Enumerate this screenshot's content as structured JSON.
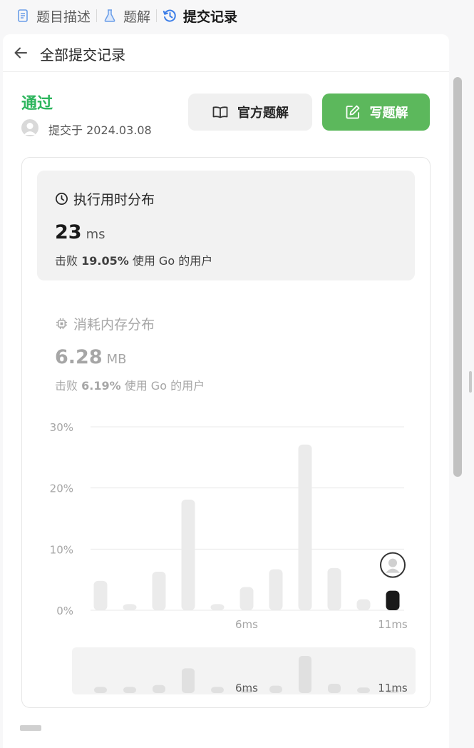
{
  "tabs": [
    {
      "label": "题目描述",
      "icon": "document-icon",
      "active": false
    },
    {
      "label": "题解",
      "icon": "flask-icon",
      "active": false
    },
    {
      "label": "提交记录",
      "icon": "history-icon",
      "active": true
    }
  ],
  "header": {
    "title": "全部提交记录"
  },
  "submission": {
    "status": "通过",
    "status_color": "#2db55d",
    "submitted_at": "提交于 2024.03.08"
  },
  "buttons": {
    "official": "官方题解",
    "write": "写题解"
  },
  "runtime": {
    "title": "执行用时分布",
    "value": "23",
    "unit": "ms",
    "beats_prefix": "击败",
    "beats_pct": "19.05%",
    "beats_suffix": "使用 Go 的用户"
  },
  "memory": {
    "title": "消耗内存分布",
    "value": "6.28",
    "unit": "MB",
    "beats_prefix": "击败",
    "beats_pct": "6.19%",
    "beats_suffix": "使用 Go 的用户"
  },
  "chart_data": {
    "type": "bar",
    "y_ticks": [
      "30%",
      "20%",
      "10%",
      "0%"
    ],
    "ylim": [
      0,
      30
    ],
    "x_tick_labels": [
      {
        "index": 5,
        "label": "6ms"
      },
      {
        "index": 10,
        "label": "11ms"
      }
    ],
    "values": [
      4.8,
      1.0,
      6.3,
      18.1,
      1.0,
      3.8,
      6.7,
      27.1,
      6.9,
      1.8,
      3.2
    ],
    "highlight_index": 10,
    "bar_color": "#ebebeb",
    "highlight_color": "#1a1a1a",
    "minimap": {
      "values": [
        1.0,
        1.0,
        1.3,
        4.0,
        1.0,
        0.6,
        1.2,
        6.0,
        1.5,
        0.9,
        0.5
      ],
      "x_tick_labels": [
        {
          "index": 5,
          "label": "6ms"
        },
        {
          "index": 10,
          "label": "11ms"
        }
      ]
    }
  }
}
